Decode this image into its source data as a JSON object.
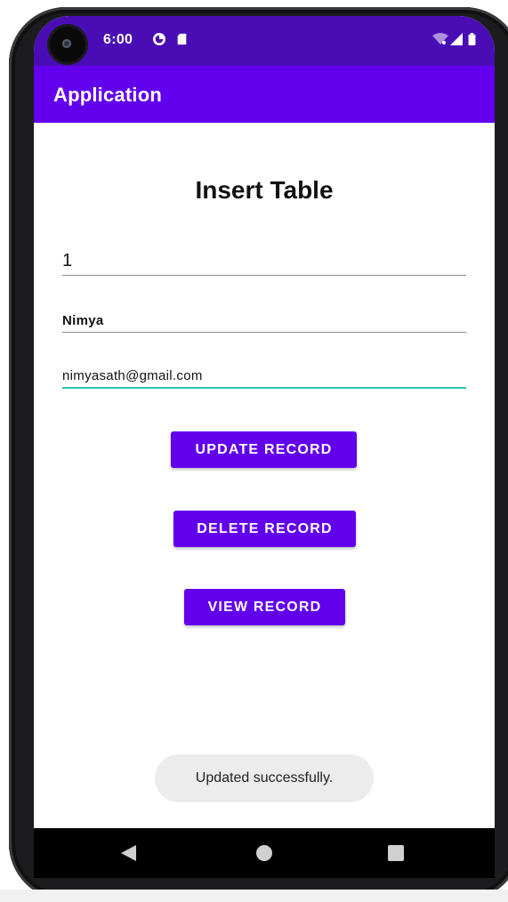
{
  "status_bar": {
    "time": "6:00",
    "icons": [
      "data-saver-icon",
      "sd-card-icon",
      "wifi-icon",
      "signal-icon",
      "battery-icon"
    ]
  },
  "app_bar": {
    "title": "Application"
  },
  "page": {
    "heading": "Insert Table"
  },
  "form": {
    "id_value": "1",
    "name_value": "Nimya",
    "email_value": "nimyasath@gmail.com"
  },
  "buttons": {
    "update_label": "UPDATE RECORD",
    "delete_label": "DELETE RECORD",
    "view_label": "VIEW RECORD"
  },
  "toast": {
    "message": "Updated successfully."
  },
  "colors": {
    "status_bar": "#4a0db5",
    "primary": "#6200ee",
    "accent": "#2bbfae",
    "toast_bg": "#ececec"
  }
}
